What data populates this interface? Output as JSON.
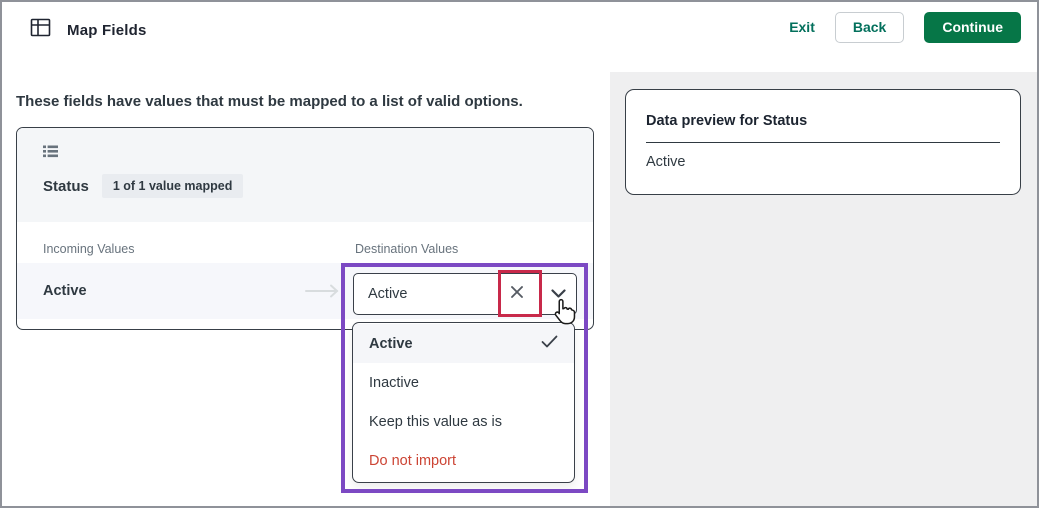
{
  "header": {
    "title": "Map Fields",
    "exit_label": "Exit",
    "back_label": "Back",
    "continue_label": "Continue"
  },
  "main": {
    "instruction": "These fields have values that must be mapped to a list of valid options.",
    "field_card": {
      "field_name": "Status",
      "mapped_badge": "1 of 1 value mapped",
      "incoming_column": "Incoming Values",
      "destination_column": "Destination Values",
      "row": {
        "incoming_value": "Active",
        "destination_value": "Active"
      }
    },
    "dropdown": {
      "options": [
        {
          "label": "Active",
          "selected": true
        },
        {
          "label": "Inactive",
          "selected": false
        },
        {
          "label": "Keep this value as is",
          "selected": false
        },
        {
          "label": "Do not import",
          "selected": false,
          "danger": true
        }
      ]
    }
  },
  "preview_panel": {
    "title": "Data preview for Status",
    "value": "Active"
  },
  "icons": {
    "header": "table-grid-icon",
    "field": "list-icon",
    "arrow": "arrow-right-icon",
    "clear": "x-icon",
    "expand": "chevron-down-icon",
    "selected": "check-icon",
    "cursor": "hand-pointer-cursor"
  },
  "colors": {
    "accent_green": "#067647",
    "link_green": "#03705c",
    "highlight_purple": "#7c49c3",
    "highlight_red": "#c8294a",
    "danger_text": "#cc4434",
    "panel_gray": "#efeff0",
    "card_header_gray": "#f4f6f8",
    "row_highlight": "#f6f7fb"
  }
}
